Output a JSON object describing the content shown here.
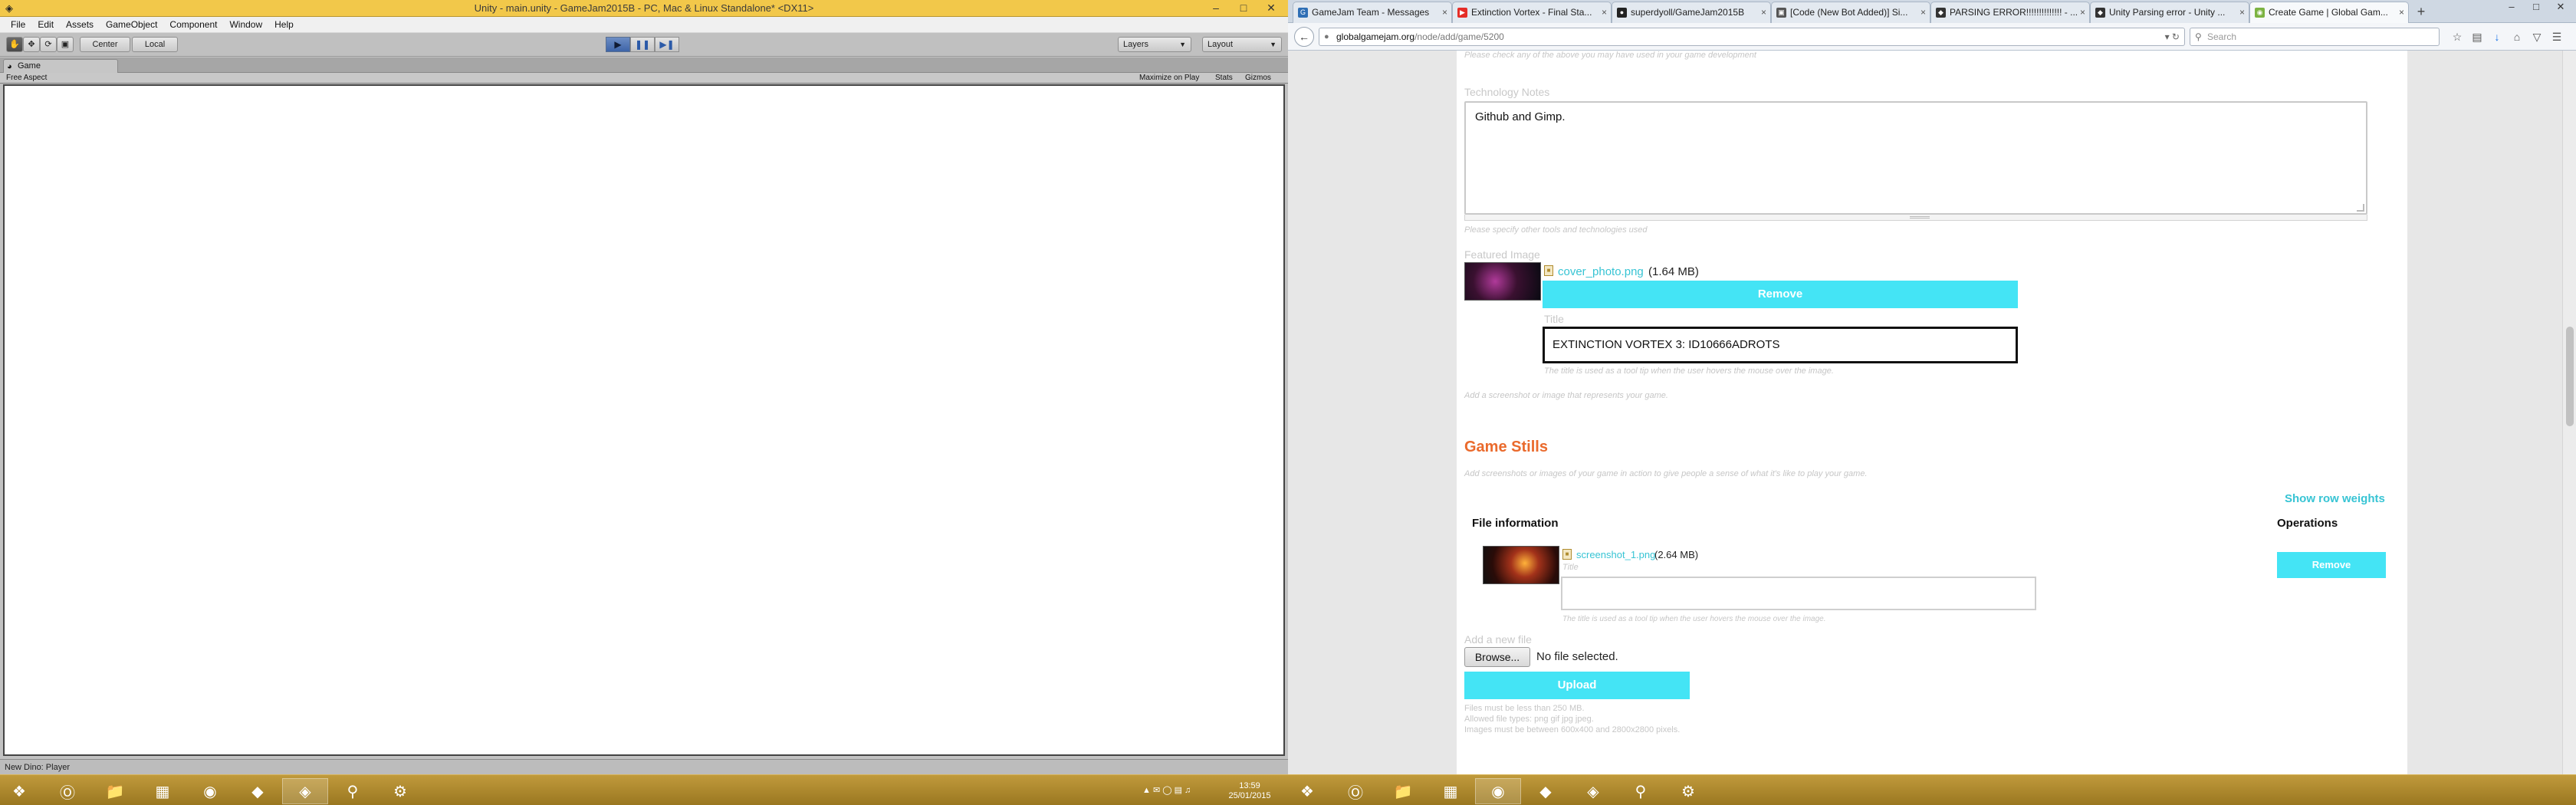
{
  "unity": {
    "title": "Unity - main.unity - GameJam2015B - PC, Mac & Linux Standalone* <DX11>",
    "window_controls": [
      "–",
      "□",
      "✕"
    ],
    "menu": [
      "File",
      "Edit",
      "Assets",
      "GameObject",
      "Component",
      "Window",
      "Help"
    ],
    "toolbar": {
      "pivot_label": "Center",
      "space_label": "Local",
      "layers_label": "Layers",
      "layout_label": "Layout"
    },
    "game_tab": {
      "label": "Game",
      "aspect": "Free Aspect",
      "maximize": "Maximize on Play",
      "stats": "Stats",
      "gizmos": "Gizmos"
    },
    "status": "New Dino: Player"
  },
  "taskbar": {
    "left_clock": {
      "time": "13:59",
      "date": "25/01/2015"
    }
  },
  "firefox": {
    "tabs": [
      {
        "label": "GameJam Team - Messages",
        "color": "#2f6fb5",
        "glyph": "G"
      },
      {
        "label": "Extinction Vortex - Final Sta...",
        "color": "#e52d27",
        "glyph": "▶"
      },
      {
        "label": "superdyoll/GameJam2015B",
        "color": "#222222",
        "glyph": "●"
      },
      {
        "label": "[Code (New Bot Added)] Si...",
        "color": "#555555",
        "glyph": "▣"
      },
      {
        "label": "PARSING ERROR!!!!!!!!!!!!!! - ...",
        "color": "#333333",
        "glyph": "◆"
      },
      {
        "label": "Unity Parsing error - Unity ...",
        "color": "#333333",
        "glyph": "◆"
      },
      {
        "label": "Create Game | Global Gam...",
        "color": "#7cb342",
        "glyph": "◉"
      }
    ],
    "url_host": "globalgamejam.org",
    "url_path": "/node/add/game/5200",
    "search_placeholder": "Search",
    "form": {
      "tools_hint": "Please check any of the above you may have used in your game development",
      "tech_notes_label": "Technology Notes",
      "tech_notes_value": "Github and Gimp.",
      "tech_notes_hint": "Please specify other tools and technologies used",
      "featured_label": "Featured Image",
      "featured_file": "cover_photo.png",
      "featured_size": "(1.64 MB)",
      "remove_label": "Remove",
      "title_label": "Title",
      "title_value": "EXTINCTION VORTEX 3: ID10666ADROTS",
      "title_hint": "The title is used as a tool tip when the user hovers the mouse over the image.",
      "featured_hint": "Add a screenshot or image that represents your game.",
      "stills_heading": "Game Stills",
      "stills_hint": "Add screenshots or images of your game in action to give people a sense of what it's like to play your game.",
      "row_weights": "Show row weights",
      "col_file_info": "File information",
      "col_operations": "Operations",
      "still_file": "screenshot_1.png",
      "still_size": "(2.64 MB)",
      "still_title_label": "Title",
      "still_title_hint": "The title is used as a tool tip when the user hovers the mouse over the image.",
      "still_remove": "Remove",
      "add_file_label": "Add a new file",
      "browse_label": "Browse...",
      "no_file": "No file selected.",
      "upload_label": "Upload",
      "req1": "Files must be less than 250 MB.",
      "req2": "Allowed file types: png gif jpg jpeg.",
      "req3": "Images must be between 600x400 and 2800x2800 pixels."
    }
  }
}
